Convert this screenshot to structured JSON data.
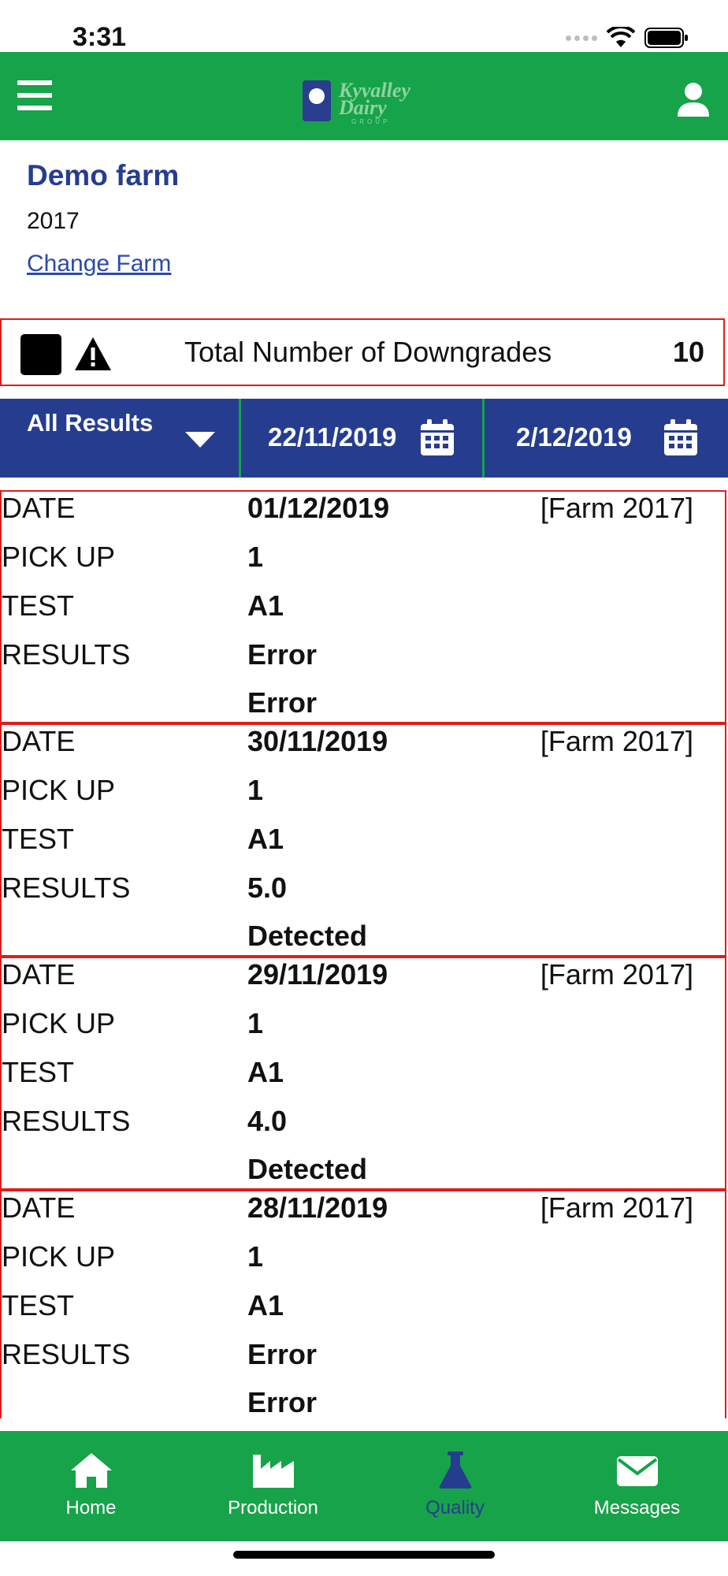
{
  "status_bar": {
    "time": "3:31"
  },
  "header": {
    "logo": {
      "line1": "Kyvalley",
      "line2": "Dairy",
      "line3": "GROUP"
    },
    "menu_icon": "hamburger-menu-icon",
    "user_icon": "user-icon"
  },
  "farm": {
    "name": "Demo farm",
    "number": "2017",
    "change_label": "Change Farm"
  },
  "summary": {
    "label": "Total Number of Downgrades",
    "count": "10"
  },
  "filters": {
    "result_type": "All Results",
    "start_date": "22/11/2019",
    "end_date": "2/12/2019"
  },
  "labels": {
    "date": "DATE",
    "pickup": "PICK UP",
    "test": "TEST",
    "results": "RESULTS"
  },
  "records": [
    {
      "date": "01/12/2019",
      "farm": "[Farm 2017]",
      "pickup": "1",
      "test": "A1",
      "result": "Error",
      "result2": "Error"
    },
    {
      "date": "30/11/2019",
      "farm": "[Farm 2017]",
      "pickup": "1",
      "test": "A1",
      "result": "5.0",
      "result2": "Detected"
    },
    {
      "date": "29/11/2019",
      "farm": "[Farm 2017]",
      "pickup": "1",
      "test": "A1",
      "result": "4.0",
      "result2": "Detected"
    },
    {
      "date": "28/11/2019",
      "farm": "[Farm 2017]",
      "pickup": "1",
      "test": "A1",
      "result": "Error",
      "result2": "Error"
    }
  ],
  "nav": [
    {
      "label": "Home",
      "icon": "home-icon"
    },
    {
      "label": "Production",
      "icon": "factory-icon"
    },
    {
      "label": "Quality",
      "icon": "flask-icon",
      "active": true
    },
    {
      "label": "Messages",
      "icon": "envelope-icon"
    }
  ],
  "colors": {
    "brand_green": "#17a349",
    "brand_blue": "#263d8f",
    "border_red": "#e21b1b"
  }
}
